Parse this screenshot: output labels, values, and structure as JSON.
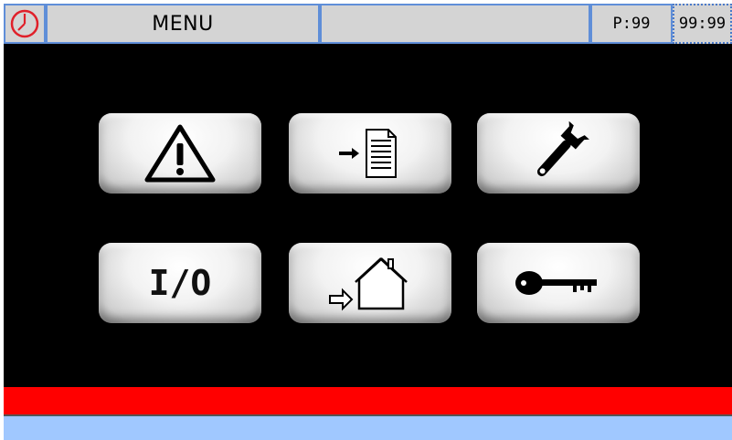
{
  "header": {
    "title": "MENU",
    "page_indicator": "P:99",
    "time": "99:99"
  },
  "icons": {
    "clock": "clock-icon",
    "alarms": "warning-triangle-icon",
    "log": "arrow-document-icon",
    "service": "wrench-icon",
    "io_label": "I/O",
    "home": "arrow-home-icon",
    "login": "key-icon"
  },
  "colors": {
    "topbar_bg": "#d4d4d4",
    "topbar_border": "#5f8ed8",
    "main_bg": "#000000",
    "alarm_bar": "#ff0000",
    "status_bar": "#a0c8ff",
    "clock_red": "#e0202a"
  },
  "footer": {
    "alarm_text": "",
    "status_text": ""
  }
}
